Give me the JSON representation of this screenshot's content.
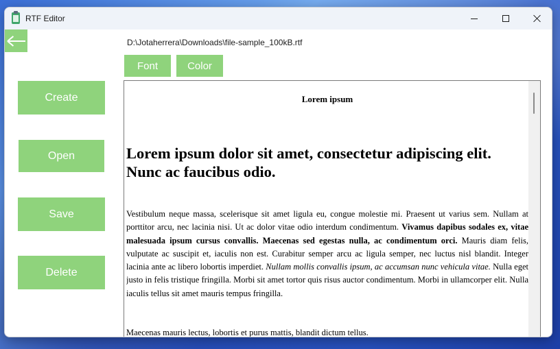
{
  "window": {
    "title": "RTF Editor"
  },
  "icons": {
    "app": "notepad-icon",
    "back": "arrow-left-icon",
    "minimize": "minimize-icon",
    "maximize": "maximize-icon",
    "close": "close-icon"
  },
  "colors": {
    "accent_green": "#8fd37c",
    "button_text": "#ffffff",
    "titlebar": "#eff3f9"
  },
  "file_path": "D:\\Jotaherrera\\Downloads\\file-sample_100kB.rtf",
  "toolbar": {
    "font_label": "Font",
    "color_label": "Color"
  },
  "sidebar": {
    "create_label": "Create",
    "open_label": "Open",
    "save_label": "Save",
    "delete_label": "Delete"
  },
  "document": {
    "title": "Lorem ipsum",
    "heading": "Lorem ipsum dolor sit amet, consectetur adipiscing elit. Nunc ac faucibus odio.",
    "para1": {
      "part1": "Vestibulum neque massa, scelerisque sit amet ligula eu, congue molestie mi. Praesent ut varius sem. Nullam at porttitor arcu, nec lacinia nisi. Ut ac dolor vitae odio interdum condimentum. ",
      "bold": "Vivamus dapibus sodales ex, vitae malesuada ipsum cursus convallis. Maecenas sed egestas nulla, ac condimentum orci.",
      "part2": " Mauris diam felis, vulputate ac suscipit et, iaculis non est. Curabitur semper arcu ac ligula semper, nec luctus nisl blandit. Integer lacinia ante ac libero lobortis imperdiet. ",
      "italic": "Nullam mollis convallis ipsum, ac accumsan nunc vehicula vitae.",
      "part3": " Nulla eget justo in felis tristique fringilla. Morbi sit amet tortor quis risus auctor condimentum. Morbi in ullamcorper elit. Nulla iaculis tellus sit amet mauris tempus fringilla."
    },
    "para2_partial": "Maecenas mauris lectus, lobortis et purus mattis, blandit dictum tellus."
  }
}
